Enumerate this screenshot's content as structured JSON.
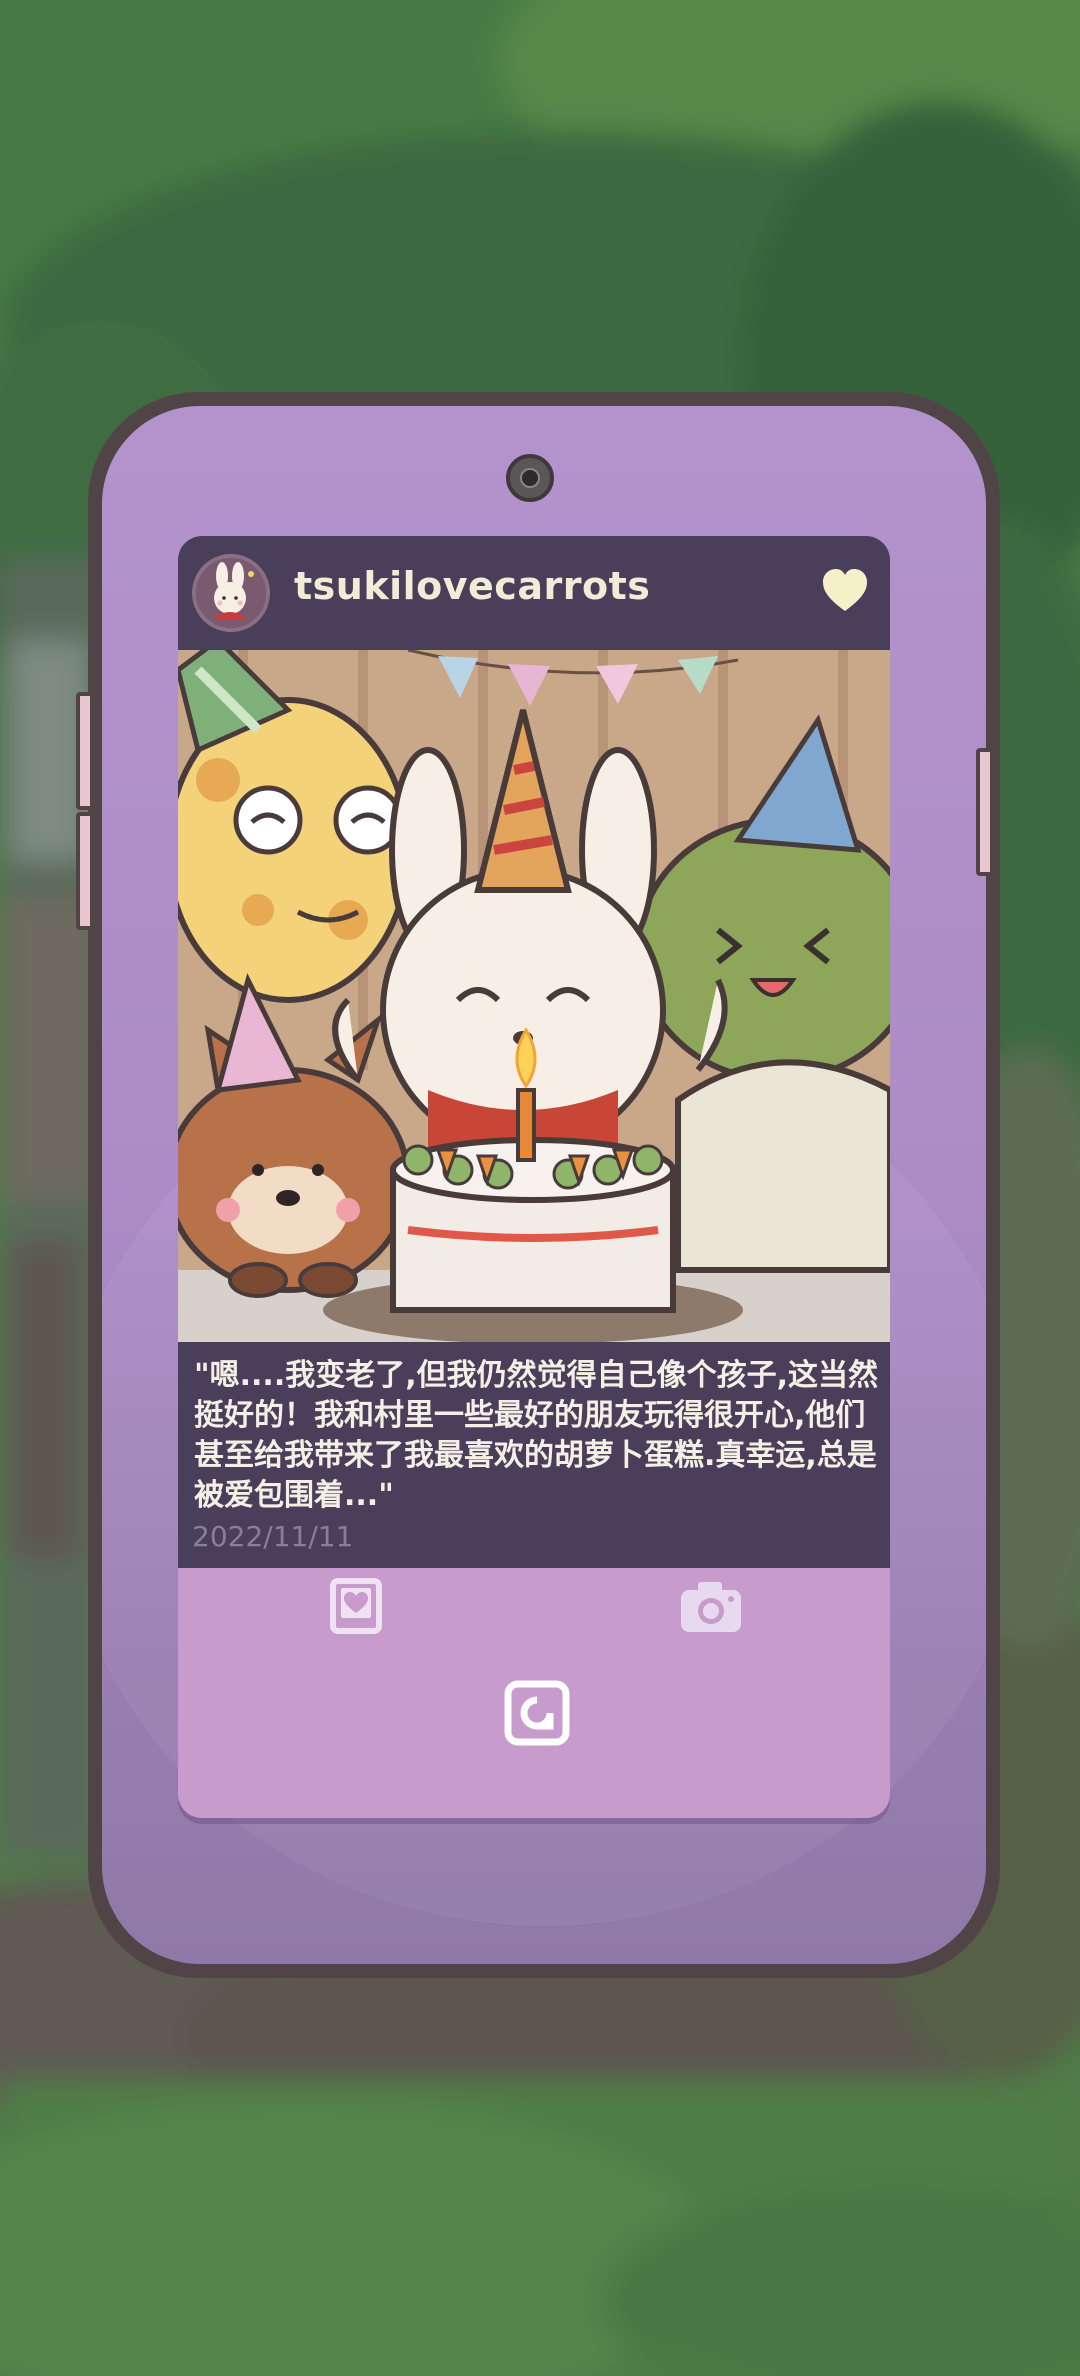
{
  "post": {
    "username": "tsukilovecarrots",
    "caption": "\"嗯....我变老了,但我仍然觉得自己像个孩子,这当然挺好的！我和村里一些最好的朋友玩得很开心,他们甚至给我带来了我最喜欢的胡萝卜蛋糕.真幸运,总是被爱包围着...\"",
    "date": "2022/11/11",
    "liked": true
  },
  "icons": {
    "like": "heart-icon",
    "favorites": "heart-card-icon",
    "camera": "camera-icon",
    "home": "app-logo-icon"
  },
  "colors": {
    "phone_body": "#b493cc",
    "phone_frame": "#514446",
    "header_bg": "#4a3f5a",
    "screen_bg": "#c79bcc",
    "text_light": "#f5f0e6",
    "date_text": "#8f7ba0",
    "heart": "#f5f0c8"
  }
}
